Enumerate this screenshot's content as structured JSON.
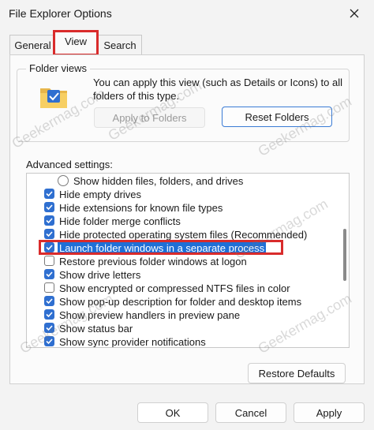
{
  "window": {
    "title": "File Explorer Options"
  },
  "tabs": [
    {
      "label": "General"
    },
    {
      "label": "View"
    },
    {
      "label": "Search"
    }
  ],
  "folder_views": {
    "title": "Folder views",
    "description": "You can apply this view (such as Details or Icons) to all folders of this type.",
    "apply_button": "Apply to Folders",
    "reset_button": "Reset Folders"
  },
  "advanced": {
    "label": "Advanced settings:",
    "items": [
      {
        "text": "Show hidden files, folders, and drives",
        "type": "radio",
        "checked": false
      },
      {
        "text": "Hide empty drives",
        "type": "checkbox",
        "checked": true
      },
      {
        "text": "Hide extensions for known file types",
        "type": "checkbox",
        "checked": true
      },
      {
        "text": "Hide folder merge conflicts",
        "type": "checkbox",
        "checked": true
      },
      {
        "text": "Hide protected operating system files (Recommended)",
        "type": "checkbox",
        "checked": true
      },
      {
        "text": "Launch folder windows in a separate process",
        "type": "checkbox",
        "checked": true,
        "selected": true
      },
      {
        "text": "Restore previous folder windows at logon",
        "type": "checkbox",
        "checked": false
      },
      {
        "text": "Show drive letters",
        "type": "checkbox",
        "checked": true
      },
      {
        "text": "Show encrypted or compressed NTFS files in color",
        "type": "checkbox",
        "checked": false
      },
      {
        "text": "Show pop-up description for folder and desktop items",
        "type": "checkbox",
        "checked": true
      },
      {
        "text": "Show preview handlers in preview pane",
        "type": "checkbox",
        "checked": true
      },
      {
        "text": "Show status bar",
        "type": "checkbox",
        "checked": true
      },
      {
        "text": "Show sync provider notifications",
        "type": "checkbox",
        "checked": true
      }
    ],
    "restore_defaults": "Restore Defaults"
  },
  "footer": {
    "ok": "OK",
    "cancel": "Cancel",
    "apply": "Apply"
  },
  "watermark": "Geekermag.com",
  "colors": {
    "accent": "#2f6fd0",
    "highlight": "#d92b2b",
    "selection": "#1f6fd6"
  }
}
